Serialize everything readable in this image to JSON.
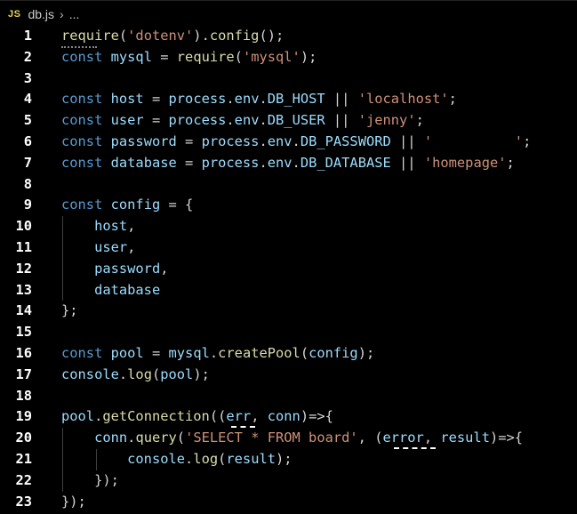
{
  "breadcrumb": {
    "badge": "JS",
    "file": "db.js",
    "chevron": "›",
    "ellipsis": "..."
  },
  "colors": {
    "keyword": "#569cd6",
    "identifier": "#9cdcfe",
    "string": "#ce9178",
    "function": "#dcdcaa",
    "punct": "#d4d4d4",
    "line_number": "#ffffff",
    "background": "#000000"
  },
  "lines": [
    {
      "n": "1",
      "tokens": [
        [
          "require",
          "f"
        ],
        [
          "(",
          "p"
        ],
        [
          "'dotenv'",
          "s"
        ],
        [
          ").",
          "p"
        ],
        [
          "config",
          "f"
        ],
        [
          "();",
          "p"
        ]
      ]
    },
    {
      "n": "2",
      "tokens": [
        [
          "const",
          "k"
        ],
        [
          " ",
          "p"
        ],
        [
          "mysql",
          "v"
        ],
        [
          " = ",
          "p"
        ],
        [
          "require",
          "f"
        ],
        [
          "(",
          "p"
        ],
        [
          "'mysql'",
          "s"
        ],
        [
          ");",
          "p"
        ]
      ]
    },
    {
      "n": "3",
      "tokens": []
    },
    {
      "n": "4",
      "tokens": [
        [
          "const",
          "k"
        ],
        [
          " ",
          "p"
        ],
        [
          "host",
          "v"
        ],
        [
          " = ",
          "p"
        ],
        [
          "process",
          "v"
        ],
        [
          ".",
          "p"
        ],
        [
          "env",
          "v"
        ],
        [
          ".",
          "p"
        ],
        [
          "DB_HOST",
          "v"
        ],
        [
          " || ",
          "p"
        ],
        [
          "'localhost'",
          "s"
        ],
        [
          ";",
          "p"
        ]
      ]
    },
    {
      "n": "5",
      "tokens": [
        [
          "const",
          "k"
        ],
        [
          " ",
          "p"
        ],
        [
          "user",
          "v"
        ],
        [
          " = ",
          "p"
        ],
        [
          "process",
          "v"
        ],
        [
          ".",
          "p"
        ],
        [
          "env",
          "v"
        ],
        [
          ".",
          "p"
        ],
        [
          "DB_USER",
          "v"
        ],
        [
          " || ",
          "p"
        ],
        [
          "'jenny'",
          "s"
        ],
        [
          ";",
          "p"
        ]
      ]
    },
    {
      "n": "6",
      "tokens": [
        [
          "const",
          "k"
        ],
        [
          " ",
          "p"
        ],
        [
          "password",
          "v"
        ],
        [
          " = ",
          "p"
        ],
        [
          "process",
          "v"
        ],
        [
          ".",
          "p"
        ],
        [
          "env",
          "v"
        ],
        [
          ".",
          "p"
        ],
        [
          "DB_PASSWORD",
          "v"
        ],
        [
          " || ",
          "p"
        ],
        [
          "'",
          "s"
        ],
        [
          "          ",
          "s"
        ],
        [
          "'",
          "s"
        ],
        [
          ";",
          "p"
        ]
      ]
    },
    {
      "n": "7",
      "tokens": [
        [
          "const",
          "k"
        ],
        [
          " ",
          "p"
        ],
        [
          "database",
          "v"
        ],
        [
          " = ",
          "p"
        ],
        [
          "process",
          "v"
        ],
        [
          ".",
          "p"
        ],
        [
          "env",
          "v"
        ],
        [
          ".",
          "p"
        ],
        [
          "DB_DATABASE",
          "v"
        ],
        [
          " || ",
          "p"
        ],
        [
          "'homepage'",
          "s"
        ],
        [
          ";",
          "p"
        ]
      ]
    },
    {
      "n": "8",
      "tokens": []
    },
    {
      "n": "9",
      "tokens": [
        [
          "const",
          "k"
        ],
        [
          " ",
          "p"
        ],
        [
          "config",
          "v"
        ],
        [
          " = {",
          "p"
        ]
      ]
    },
    {
      "n": "10",
      "tokens": [
        [
          "    ",
          "p"
        ],
        [
          "host",
          "v"
        ],
        [
          ",",
          "p"
        ]
      ]
    },
    {
      "n": "11",
      "tokens": [
        [
          "    ",
          "p"
        ],
        [
          "user",
          "v"
        ],
        [
          ",",
          "p"
        ]
      ]
    },
    {
      "n": "12",
      "tokens": [
        [
          "    ",
          "p"
        ],
        [
          "password",
          "v"
        ],
        [
          ",",
          "p"
        ]
      ]
    },
    {
      "n": "13",
      "tokens": [
        [
          "    ",
          "p"
        ],
        [
          "database",
          "v"
        ]
      ]
    },
    {
      "n": "14",
      "tokens": [
        [
          "};",
          "p"
        ]
      ]
    },
    {
      "n": "15",
      "tokens": []
    },
    {
      "n": "16",
      "tokens": [
        [
          "const",
          "k"
        ],
        [
          " ",
          "p"
        ],
        [
          "pool",
          "v"
        ],
        [
          " = ",
          "p"
        ],
        [
          "mysql",
          "v"
        ],
        [
          ".",
          "p"
        ],
        [
          "createPool",
          "f"
        ],
        [
          "(",
          "p"
        ],
        [
          "config",
          "v"
        ],
        [
          ");",
          "p"
        ]
      ]
    },
    {
      "n": "17",
      "tokens": [
        [
          "console",
          "v"
        ],
        [
          ".",
          "p"
        ],
        [
          "log",
          "f"
        ],
        [
          "(",
          "p"
        ],
        [
          "pool",
          "v"
        ],
        [
          ");",
          "p"
        ]
      ]
    },
    {
      "n": "18",
      "tokens": []
    },
    {
      "n": "19",
      "tokens": [
        [
          "pool",
          "v"
        ],
        [
          ".",
          "p"
        ],
        [
          "getConnection",
          "f"
        ],
        [
          "((",
          "p"
        ],
        [
          "err",
          "v"
        ],
        [
          ", ",
          "p"
        ],
        [
          "conn",
          "v"
        ],
        [
          ")=>{",
          "p"
        ]
      ]
    },
    {
      "n": "20",
      "tokens": [
        [
          "    ",
          "p"
        ],
        [
          "conn",
          "v"
        ],
        [
          ".",
          "p"
        ],
        [
          "query",
          "f"
        ],
        [
          "(",
          "p"
        ],
        [
          "'SELECT * FROM board'",
          "s"
        ],
        [
          ", (",
          "p"
        ],
        [
          "error",
          "v"
        ],
        [
          ", ",
          "p"
        ],
        [
          "result",
          "v"
        ],
        [
          ")=>{",
          "p"
        ]
      ]
    },
    {
      "n": "21",
      "tokens": [
        [
          "        ",
          "p"
        ],
        [
          "console",
          "v"
        ],
        [
          ".",
          "p"
        ],
        [
          "log",
          "f"
        ],
        [
          "(",
          "p"
        ],
        [
          "result",
          "v"
        ],
        [
          ");",
          "p"
        ]
      ]
    },
    {
      "n": "22",
      "tokens": [
        [
          "    ",
          "p"
        ],
        [
          "});",
          "p"
        ]
      ]
    },
    {
      "n": "23",
      "tokens": [
        [
          "});",
          "p"
        ]
      ]
    }
  ]
}
